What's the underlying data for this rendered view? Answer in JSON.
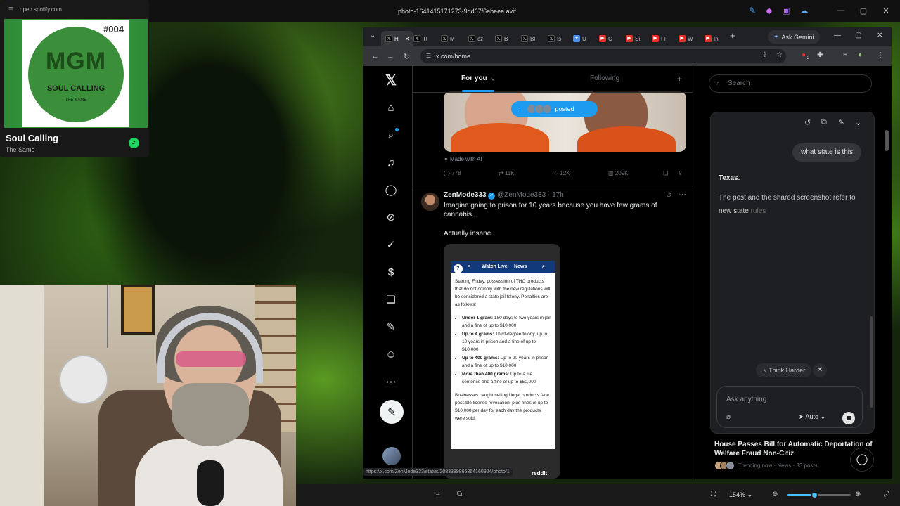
{
  "window": {
    "title": "photo-1641415171273-9dd67f6ebeee.avif",
    "controls": [
      "—",
      "▢",
      "✕"
    ]
  },
  "spotify": {
    "url": "open.spotify.com",
    "album_number": "#004",
    "logo_text": "MGM",
    "art_title": "SOUL CALLING",
    "art_subtitle": "THE SAME",
    "song": "Soul Calling",
    "artist": "The Same",
    "saved_icon": "check-icon"
  },
  "browser": {
    "tabs": [
      {
        "label": "H",
        "icon": "x-logo",
        "active": true
      },
      {
        "label": "Tl",
        "icon": "x-logo"
      },
      {
        "label": "M",
        "icon": "x-logo"
      },
      {
        "label": "cz",
        "icon": "x-logo"
      },
      {
        "label": "B",
        "icon": "x-logo"
      },
      {
        "label": "Bl",
        "icon": "x-logo"
      },
      {
        "label": "Is",
        "icon": "x-logo"
      },
      {
        "label": "U",
        "icon": "butterfly"
      },
      {
        "label": "C",
        "icon": "youtube"
      },
      {
        "label": "Si",
        "icon": "youtube"
      },
      {
        "label": "Fl",
        "icon": "youtube"
      },
      {
        "label": "W",
        "icon": "youtube"
      },
      {
        "label": "In",
        "icon": "youtube"
      }
    ],
    "new_tab": "+",
    "ask_gemini": "Ask Gemini",
    "url": "x.com/home",
    "extension_badge": "2"
  },
  "feed": {
    "tab_for_you": "For you",
    "tab_following": "Following",
    "posted_pill": "posted",
    "made_with_ai": "Made with AI",
    "stats": {
      "replies": "778",
      "reposts": "11K",
      "likes": "12K",
      "views": "209K"
    },
    "tweet": {
      "name": "ZenMode333",
      "handle": "@ZenMode333",
      "time": "· 17h",
      "text": "Imagine going to prison for 10 years because you have few grams of cannabis.",
      "text2": "Actually insane."
    },
    "screenshot": {
      "logo": "7",
      "watch_live": "Watch Live",
      "news": "News",
      "intro": "Starting Friday, possession of THC products that do not comply with the new regulations will be considered a state jail felony. Penalties are as follows:",
      "items": [
        {
          "bold": "Under 1 gram:",
          "text": " 180 days to two years in jail and a fine of up to $10,000"
        },
        {
          "bold": "Up to 4 grams:",
          "text": " Third-degree felony, up to 10 years in prison and a fine of up to $10,000"
        },
        {
          "bold": "Up to 400 grams:",
          "text": " Up to 20 years in prison and a fine of up to $10,000"
        },
        {
          "bold": "More than 400 grams:",
          "text": " Up to a life sentence and a fine of up to $50,000"
        }
      ],
      "outro": "Businesses caught selling illegal products face possible license revocation, plus fines of up to $10,000 per day for each day the products were sold."
    },
    "status_url": "https://x.com/ZenMode333/status/2083389866864160924/photo/1",
    "reddit_label": "reddit"
  },
  "sidebar_right": {
    "search_placeholder": "Search",
    "trend_title": "House Passes Bill for Automatic Deportation of Welfare Fraud Non-Citiz",
    "trend_meta": "Trending now · News · 33 posts"
  },
  "gemini": {
    "user_message": "what state is this",
    "answer_bold": "Texas.",
    "answer_text": "The post and the shared screenshot refer to new state",
    "answer_fade": "rules",
    "think_harder": "Think Harder",
    "input_placeholder": "Ask anything",
    "mode": "Auto"
  },
  "viewer": {
    "zoom": "154%",
    "zoom_level": 0.42
  },
  "colors": {
    "x_blue": "#1d9bf0",
    "spotify_green": "#1ed760",
    "zoom_accent": "#4cc2ff"
  }
}
